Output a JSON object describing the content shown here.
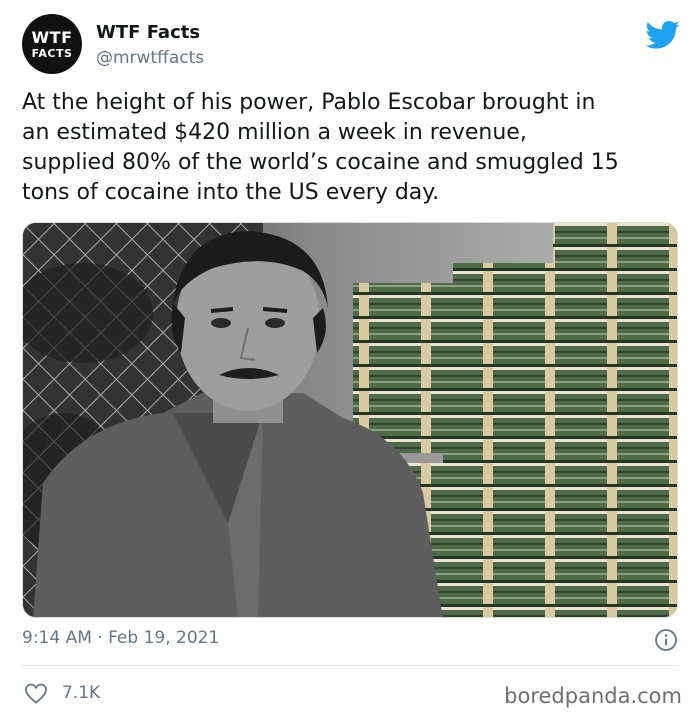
{
  "account": {
    "avatar_line1": "WTF",
    "avatar_line2": "FACTS",
    "name": "WTF Facts",
    "handle": "@mrwtffacts"
  },
  "tweet": {
    "text": "At the height of his power, Pablo Escobar brought in\nan estimated $420 million a week in revenue,\nsupplied 80% of the world’s cocaine and smuggled 15\ntons of cocaine into the US every day.",
    "timestamp": "9:14 AM · Feb 19, 2021",
    "likes": "7.1K"
  },
  "watermark": "boredpanda.com",
  "icons": {
    "brand": "twitter-bird-icon",
    "info": "info-icon",
    "like": "heart-icon"
  },
  "colors": {
    "twitter_blue": "#1da1f2",
    "muted_text": "#657786",
    "divider": "#e1e8ed"
  }
}
